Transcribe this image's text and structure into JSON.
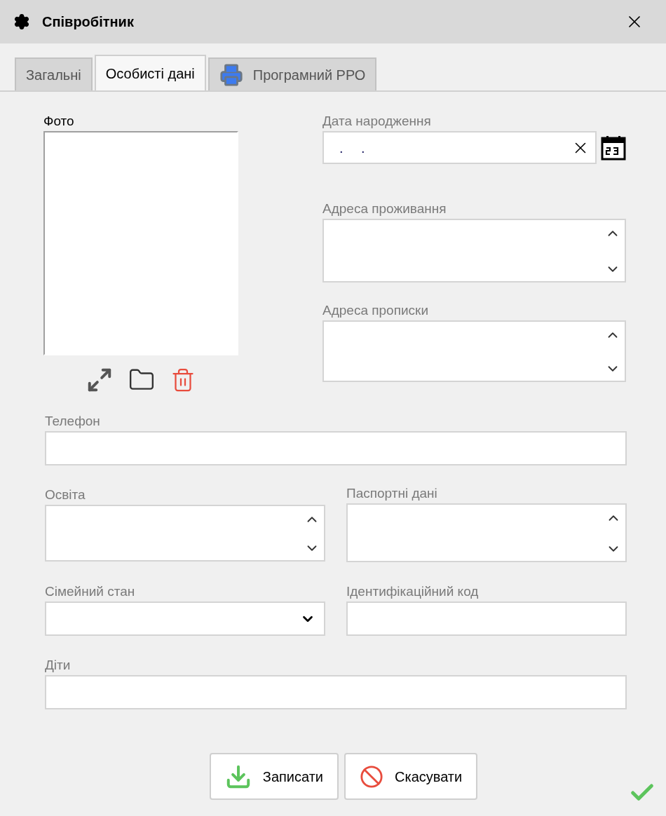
{
  "window": {
    "title": "Співробітник"
  },
  "tabs": [
    {
      "label": "Загальні",
      "selected": false,
      "has_icon": false
    },
    {
      "label": "Особисті дані",
      "selected": true,
      "has_icon": false
    },
    {
      "label": "Програмний РРО",
      "selected": false,
      "has_icon": true
    }
  ],
  "photo": {
    "label": "Фото"
  },
  "birth_date": {
    "label": "Дата народження",
    "value": ". ."
  },
  "residence_address": {
    "label": "Адреса проживання"
  },
  "registration_address": {
    "label": "Адреса прописки"
  },
  "phone": {
    "label": "Телефон"
  },
  "education": {
    "label": "Освіта"
  },
  "passport": {
    "label": "Паспортні дані"
  },
  "marital_status": {
    "label": "Сімейний стан"
  },
  "id_code": {
    "label": "Ідентифікаційний код"
  },
  "children": {
    "label": "Діти"
  },
  "buttons": [
    {
      "label": "Записати",
      "kind": "save"
    },
    {
      "label": "Скасувати",
      "kind": "cancel"
    }
  ]
}
